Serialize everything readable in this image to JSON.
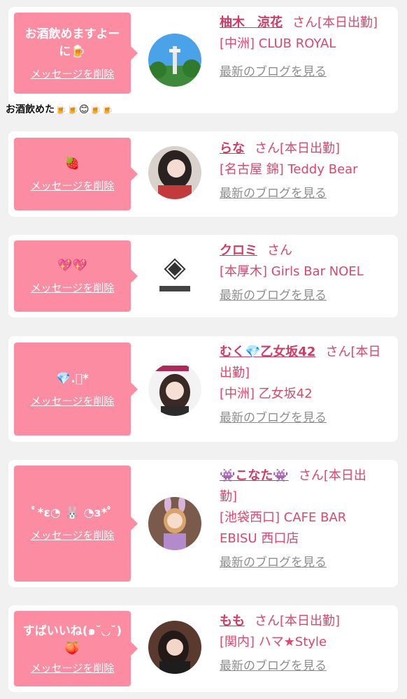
{
  "delete_label": "メッセージを削除",
  "blog_label": "最新のブログを見る",
  "san_suffix": "さん",
  "colors": {
    "bubble": "#fc8ca2",
    "name": "#d63a62",
    "text": "#e0456b",
    "link_gray": "#8e8e8e"
  },
  "entries": [
    {
      "message": "お酒飲めますよーに🍺",
      "caption": "お酒飲めた🍺🍺😊🍺🍺",
      "name": "柚木　涼花",
      "status": "[本日出勤]",
      "shop": "[中洲] CLUB ROYAL",
      "avatar_icon": "tower-photo-icon"
    },
    {
      "message": "🍓",
      "name": "らな",
      "status": "[本日出勤]",
      "shop": "[名古屋 錦] Teddy Bear",
      "avatar_icon": "girl-photo-icon"
    },
    {
      "message": "💖💖",
      "name": "クロミ",
      "status": "",
      "shop": "[本厚木] Girls Bar NOEL",
      "avatar_icon": "noel-logo-icon"
    },
    {
      "message": "💎.ﾟ*",
      "name": "むく💎乙女坂42",
      "status": "[本日出勤]",
      "shop": "[中洲] 乙女坂42",
      "avatar_icon": "girl-photo-icon"
    },
    {
      "message": "ﾟ*ε◔ 🐰 ◔з*ﾟ",
      "name": "👾こなた👾",
      "status": "[本日出勤]",
      "shop": "[池袋西口] CAFE BAR EBISU 西口店",
      "avatar_icon": "bunny-photo-icon"
    },
    {
      "message": "すばいいね(๑˘◡˘)🍑",
      "name": "もも",
      "status": "[本日出勤]",
      "shop": "[関内] ハマ★Style",
      "avatar_icon": "girl-photo-icon"
    }
  ]
}
